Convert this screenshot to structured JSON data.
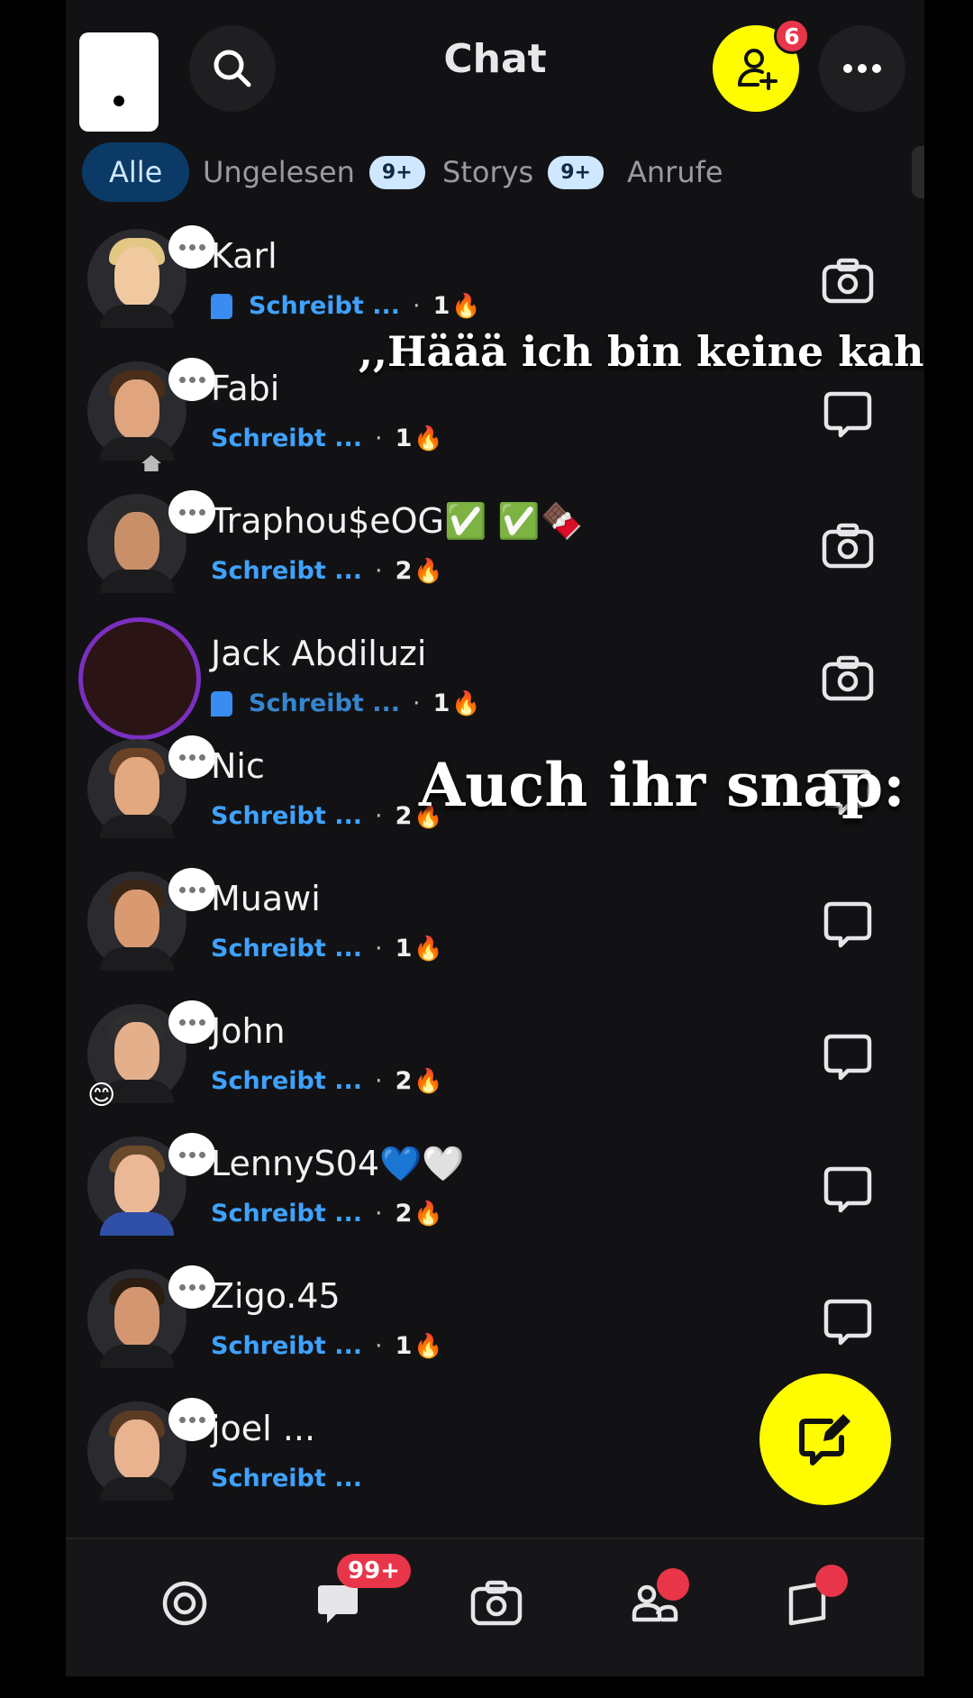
{
  "header": {
    "title": "Chat",
    "add_friend_badge": "6",
    "icons": {
      "search": "search-icon",
      "add_friend": "add-friend-icon",
      "more": "more-icon"
    }
  },
  "tabs": [
    {
      "label": "Alle",
      "active": true
    },
    {
      "label": "Ungelesen",
      "count": "9+"
    },
    {
      "label": "Storys",
      "count": "9+"
    },
    {
      "label": "Anrufe"
    }
  ],
  "chats": [
    {
      "name": "Karl",
      "status": "Schreibt ...",
      "streak": "1",
      "icon": "camera-icon"
    },
    {
      "name": "Fabi",
      "status": "Schreibt ...",
      "streak": "1",
      "icon": "chat-icon"
    },
    {
      "name": "Traphou$eOG✅ ✅🍫",
      "status": "Schreibt ...",
      "streak": "2",
      "icon": "camera-icon"
    },
    {
      "name": "Jack Abdiluzi",
      "status": "Schreibt ...",
      "streak": "1",
      "icon": "camera-icon"
    },
    {
      "name": "Nic",
      "status": "Schreibt ...",
      "streak": "2",
      "icon": "chat-icon"
    },
    {
      "name": "Muawi",
      "status": "Schreibt ...",
      "streak": "1",
      "icon": "chat-icon"
    },
    {
      "name": "John",
      "status": "Schreibt ...",
      "streak": "2",
      "icon": "chat-icon"
    },
    {
      "name": "LennyS04💙🤍",
      "status": "Schreibt ...",
      "streak": "2",
      "icon": "chat-icon"
    },
    {
      "name": "Zigo.45",
      "status": "Schreibt ...",
      "streak": "1",
      "icon": "chat-icon"
    },
    {
      "name": "joel ...",
      "status": "Schreibt ..."
    }
  ],
  "overlay": {
    "caption_top": ",,Häää ich bin keine kahh\"",
    "caption_middle": "Auch ihr snap:"
  },
  "bottom_nav": {
    "chat_badge": "99+",
    "items": [
      "map-icon",
      "chat-icon",
      "camera-icon",
      "friends-icon",
      "stories-icon"
    ]
  },
  "colors": {
    "accent_yellow": "#fffc00",
    "typing_blue": "#3fa2ff",
    "badge_red": "#e8354a",
    "tab_active_bg": "#0b3a66"
  }
}
